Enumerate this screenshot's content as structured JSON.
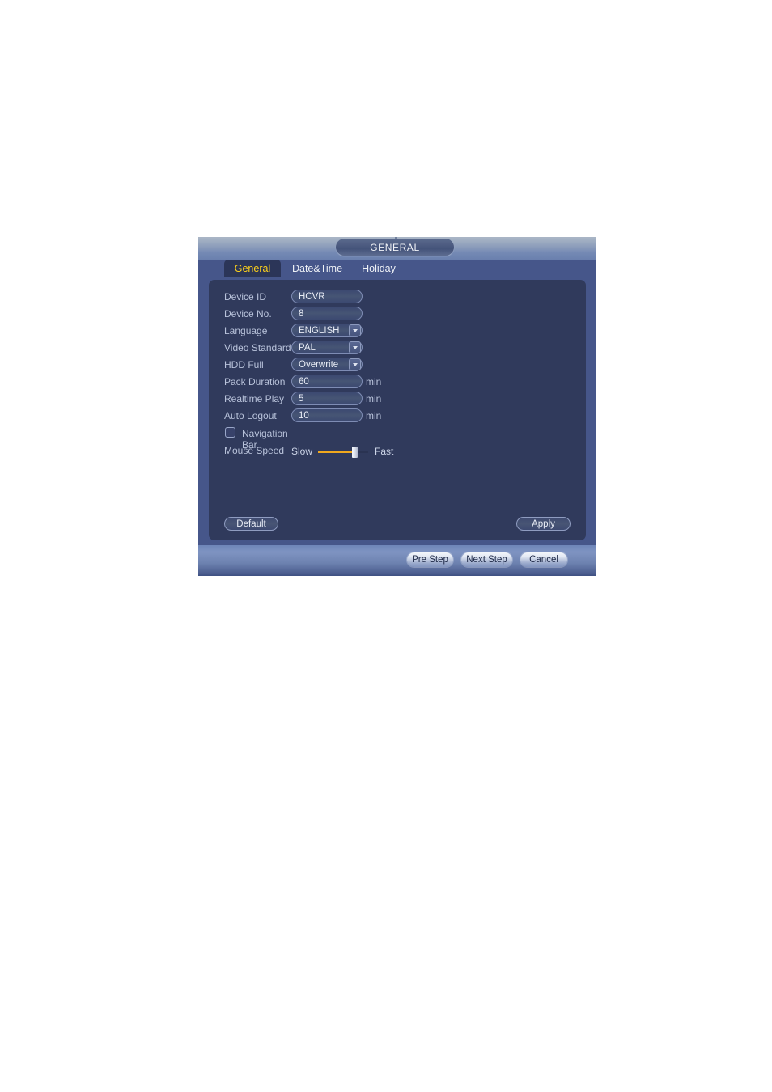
{
  "dialog": {
    "title": "GENERAL",
    "tabs": [
      {
        "label": "General",
        "active": true
      },
      {
        "label": "Date&Time",
        "active": false
      },
      {
        "label": "Holiday",
        "active": false
      }
    ],
    "fields": [
      {
        "label": "Device ID",
        "value": "HCVR",
        "type": "text",
        "unit": ""
      },
      {
        "label": "Device No.",
        "value": "8",
        "type": "text",
        "unit": ""
      },
      {
        "label": "Language",
        "value": "ENGLISH",
        "type": "select",
        "unit": ""
      },
      {
        "label": "Video Standard",
        "value": "PAL",
        "type": "select",
        "unit": ""
      },
      {
        "label": "HDD Full",
        "value": "Overwrite",
        "type": "select",
        "unit": ""
      },
      {
        "label": "Pack Duration",
        "value": "60",
        "type": "text",
        "unit": "min"
      },
      {
        "label": "Realtime Play",
        "value": "5",
        "type": "text",
        "unit": "min"
      },
      {
        "label": "Auto Logout",
        "value": "10",
        "type": "text",
        "unit": "min"
      }
    ],
    "navigation_bar": {
      "label": "Navigation Bar",
      "checked": false
    },
    "mouse_speed": {
      "label": "Mouse Speed",
      "min_label": "Slow",
      "max_label": "Fast",
      "value_percent": 78
    },
    "panel_buttons": {
      "default_label": "Default",
      "apply_label": "Apply"
    },
    "footer_buttons": {
      "pre_step_label": "Pre Step",
      "next_step_label": "Next Step",
      "cancel_label": "Cancel"
    },
    "colors": {
      "frame": "#46568a",
      "panel": "#303a5c",
      "active_tab_text": "#ffd21a",
      "active_tab_bg": "#2b3558",
      "label_text": "#b8c2da",
      "slider_fill": "#f0a81e"
    }
  }
}
